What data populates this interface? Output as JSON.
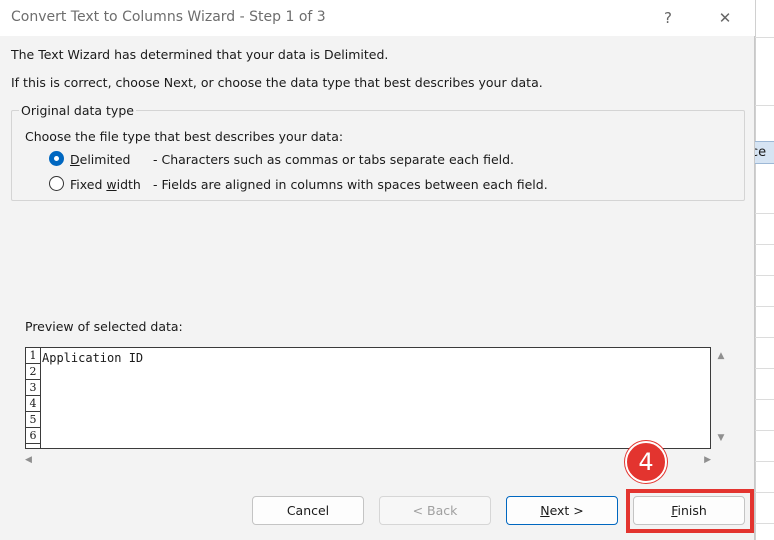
{
  "sheet": {
    "header_fragment": "ce"
  },
  "dialog": {
    "title": "Convert Text to Columns Wizard - Step 1 of 3",
    "help_glyph": "?",
    "close_glyph": "✕",
    "intro_line1": "The Text Wizard has determined that your data is Delimited.",
    "intro_line2": "If this is correct, choose Next, or choose the data type that best describes your data.",
    "group": {
      "legend": "Original data type",
      "prompt": "Choose the file type that best describes your data:",
      "options": [
        {
          "label_mnemonic": "D",
          "label_rest": "elimited",
          "description": "- Characters such as commas or tabs separate each field.",
          "selected": true
        },
        {
          "label_prefix": "Fixed ",
          "label_mnemonic": "w",
          "label_rest": "idth",
          "description": "- Fields are aligned in columns with spaces between each field.",
          "selected": false
        }
      ]
    },
    "preview": {
      "label": "Preview of selected data:",
      "line_numbers": [
        "1",
        "2",
        "3",
        "4",
        "5",
        "6"
      ],
      "first_line": "Application ID",
      "scroll_up": "▲",
      "scroll_down": "▼",
      "scroll_left": "◀",
      "scroll_right": "▶"
    },
    "buttons": {
      "cancel": "Cancel",
      "back": "< Back",
      "next_mnemonic": "N",
      "next_rest": "ext >",
      "finish_mnemonic": "F",
      "finish_rest": "inish"
    },
    "annotation": {
      "step_number": "4",
      "color": "#e3342f"
    }
  }
}
